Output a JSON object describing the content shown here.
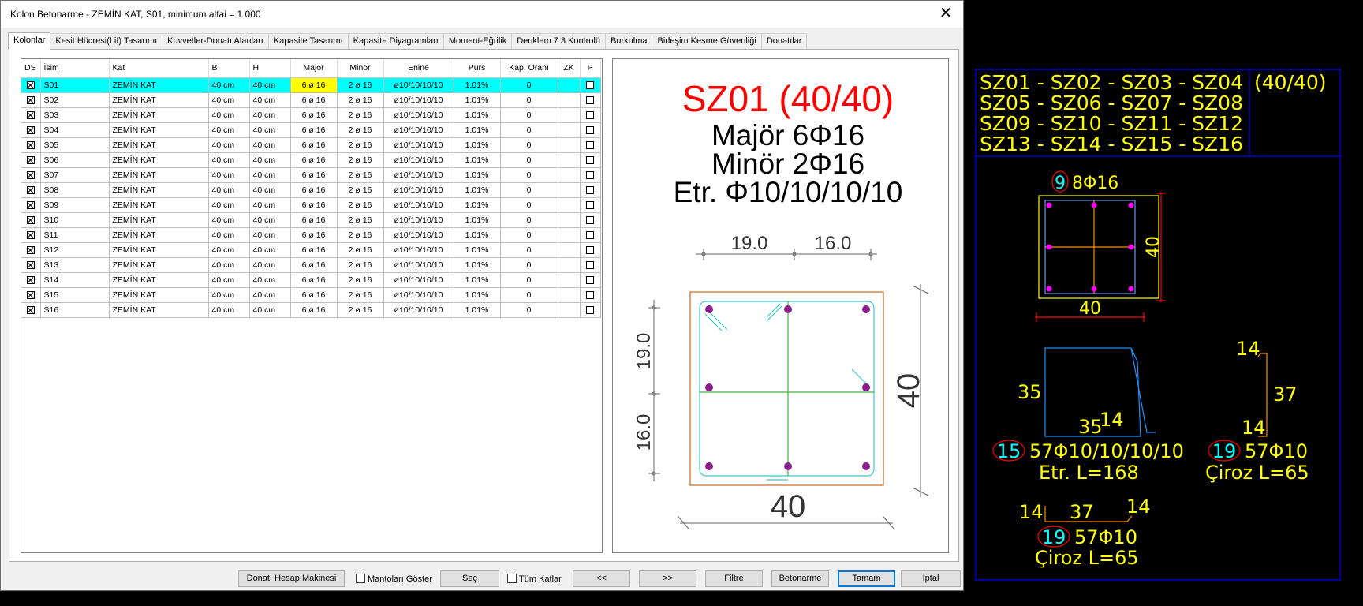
{
  "window": {
    "title": "Kolon Betonarme - ZEMİN KAT, S01, minimum alfai = 1.000",
    "close_glyph": "✕"
  },
  "tabs": [
    {
      "label": "Kolonlar",
      "active": true
    },
    {
      "label": "Kesit Hücresi(Lif) Tasarımı"
    },
    {
      "label": "Kuvvetler-Donatı Alanları"
    },
    {
      "label": "Kapasite Tasarımı"
    },
    {
      "label": "Kapasite Diyagramları"
    },
    {
      "label": "Moment-Eğrilik"
    },
    {
      "label": "Denklem 7.3 Kontrolü"
    },
    {
      "label": "Burkulma"
    },
    {
      "label": "Birleşim Kesme Güvenliği"
    },
    {
      "label": "Donatılar"
    }
  ],
  "table": {
    "headers": [
      "DS",
      "İsim",
      "Kat",
      "B",
      "H",
      "Majör",
      "Minör",
      "Enine",
      "Purs",
      "Kap. Oranı",
      "ZK",
      "P"
    ],
    "rows": [
      {
        "ds": true,
        "name": "S01",
        "kat": "ZEMİN KAT",
        "b": "40 cm",
        "h": "40 cm",
        "major": "6 ø 16",
        "minor": "2 ø 16",
        "enine": "ø10/10/10/10",
        "purs": "1.01%",
        "kap": "0",
        "zk": "",
        "p": false,
        "selected": true
      },
      {
        "ds": true,
        "name": "S02",
        "kat": "ZEMİN KAT",
        "b": "40 cm",
        "h": "40 cm",
        "major": "6 ø 16",
        "minor": "2 ø 16",
        "enine": "ø10/10/10/10",
        "purs": "1.01%",
        "kap": "0",
        "zk": "",
        "p": false
      },
      {
        "ds": true,
        "name": "S03",
        "kat": "ZEMİN KAT",
        "b": "40 cm",
        "h": "40 cm",
        "major": "6 ø 16",
        "minor": "2 ø 16",
        "enine": "ø10/10/10/10",
        "purs": "1.01%",
        "kap": "0",
        "zk": "",
        "p": false
      },
      {
        "ds": true,
        "name": "S04",
        "kat": "ZEMİN KAT",
        "b": "40 cm",
        "h": "40 cm",
        "major": "6 ø 16",
        "minor": "2 ø 16",
        "enine": "ø10/10/10/10",
        "purs": "1.01%",
        "kap": "0",
        "zk": "",
        "p": false
      },
      {
        "ds": true,
        "name": "S05",
        "kat": "ZEMİN KAT",
        "b": "40 cm",
        "h": "40 cm",
        "major": "6 ø 16",
        "minor": "2 ø 16",
        "enine": "ø10/10/10/10",
        "purs": "1.01%",
        "kap": "0",
        "zk": "",
        "p": false
      },
      {
        "ds": true,
        "name": "S06",
        "kat": "ZEMİN KAT",
        "b": "40 cm",
        "h": "40 cm",
        "major": "6 ø 16",
        "minor": "2 ø 16",
        "enine": "ø10/10/10/10",
        "purs": "1.01%",
        "kap": "0",
        "zk": "",
        "p": false
      },
      {
        "ds": true,
        "name": "S07",
        "kat": "ZEMİN KAT",
        "b": "40 cm",
        "h": "40 cm",
        "major": "6 ø 16",
        "minor": "2 ø 16",
        "enine": "ø10/10/10/10",
        "purs": "1.01%",
        "kap": "0",
        "zk": "",
        "p": false
      },
      {
        "ds": true,
        "name": "S08",
        "kat": "ZEMİN KAT",
        "b": "40 cm",
        "h": "40 cm",
        "major": "6 ø 16",
        "minor": "2 ø 16",
        "enine": "ø10/10/10/10",
        "purs": "1.01%",
        "kap": "0",
        "zk": "",
        "p": false
      },
      {
        "ds": true,
        "name": "S09",
        "kat": "ZEMİN KAT",
        "b": "40 cm",
        "h": "40 cm",
        "major": "6 ø 16",
        "minor": "2 ø 16",
        "enine": "ø10/10/10/10",
        "purs": "1.01%",
        "kap": "0",
        "zk": "",
        "p": false
      },
      {
        "ds": true,
        "name": "S10",
        "kat": "ZEMİN KAT",
        "b": "40 cm",
        "h": "40 cm",
        "major": "6 ø 16",
        "minor": "2 ø 16",
        "enine": "ø10/10/10/10",
        "purs": "1.01%",
        "kap": "0",
        "zk": "",
        "p": false
      },
      {
        "ds": true,
        "name": "S11",
        "kat": "ZEMİN KAT",
        "b": "40 cm",
        "h": "40 cm",
        "major": "6 ø 16",
        "minor": "2 ø 16",
        "enine": "ø10/10/10/10",
        "purs": "1.01%",
        "kap": "0",
        "zk": "",
        "p": false
      },
      {
        "ds": true,
        "name": "S12",
        "kat": "ZEMİN KAT",
        "b": "40 cm",
        "h": "40 cm",
        "major": "6 ø 16",
        "minor": "2 ø 16",
        "enine": "ø10/10/10/10",
        "purs": "1.01%",
        "kap": "0",
        "zk": "",
        "p": false
      },
      {
        "ds": true,
        "name": "S13",
        "kat": "ZEMİN KAT",
        "b": "40 cm",
        "h": "40 cm",
        "major": "6 ø 16",
        "minor": "2 ø 16",
        "enine": "ø10/10/10/10",
        "purs": "1.01%",
        "kap": "0",
        "zk": "",
        "p": false
      },
      {
        "ds": true,
        "name": "S14",
        "kat": "ZEMİN KAT",
        "b": "40 cm",
        "h": "40 cm",
        "major": "6 ø 16",
        "minor": "2 ø 16",
        "enine": "ø10/10/10/10",
        "purs": "1.01%",
        "kap": "0",
        "zk": "",
        "p": false
      },
      {
        "ds": true,
        "name": "S15",
        "kat": "ZEMİN KAT",
        "b": "40 cm",
        "h": "40 cm",
        "major": "6 ø 16",
        "minor": "2 ø 16",
        "enine": "ø10/10/10/10",
        "purs": "1.01%",
        "kap": "0",
        "zk": "",
        "p": false
      },
      {
        "ds": true,
        "name": "S16",
        "kat": "ZEMİN KAT",
        "b": "40 cm",
        "h": "40 cm",
        "major": "6 ø 16",
        "minor": "2 ø 16",
        "enine": "ø10/10/10/10",
        "purs": "1.01%",
        "kap": "0",
        "zk": "",
        "p": false
      }
    ]
  },
  "preview": {
    "title": "SZ01 (40/40)",
    "major": "Majör 6Φ16",
    "minor": "Minör 2Φ16",
    "etr": "Etr. Φ10/10/10/10",
    "dim_top_1": "19.0",
    "dim_top_2": "16.0",
    "dim_left_1": "19.0",
    "dim_left_2": "16.0",
    "dim_right": "40",
    "dim_bottom": "40",
    "title_color": "#ff0000"
  },
  "buttons": {
    "calc": "Donatı Hesap Makinesi",
    "show_jackets": "Mantoları Göster",
    "select": "Seç",
    "all_floors": "Tüm Katlar",
    "prev": "<<",
    "next": ">>",
    "filter": "Filtre",
    "betonarme": "Betonarme",
    "ok": "Tamam",
    "cancel": "İptal"
  },
  "cad": {
    "header_lines": [
      "SZ01 - SZ02 - SZ03 - SZ04",
      "SZ05 - SZ06 - SZ07 - SZ08",
      "SZ09 - SZ10 - SZ11 - SZ12",
      "SZ13 - SZ14 - SZ15 - SZ16"
    ],
    "header_size": "(40/40)",
    "section_mark": "9",
    "section_label": "8Φ16",
    "section_dim_right": "40",
    "section_dim_bottom": "40",
    "stirrup": {
      "dim_left": "35",
      "dim_bottom": "35",
      "dim_hook": "14",
      "mark": "15",
      "label": "57Φ10/10/10/10",
      "length": "Etr. L=168"
    },
    "tie_right": {
      "dim_top": "14",
      "dim_mid": "37",
      "dim_bottom": "14",
      "mark": "19",
      "label": "57Φ10",
      "length": "Çiroz L=65"
    },
    "tie_bottom": {
      "dim_left": "14",
      "dim_mid": "37",
      "dim_right": "14",
      "mark": "19",
      "label": "57Φ10",
      "length": "Çiroz L=65"
    },
    "colors": {
      "text": "#ffff00",
      "frame": "#0000ff",
      "mark": "#00ffff",
      "circle": "#ff0000",
      "bar": "#ff00ff"
    }
  }
}
